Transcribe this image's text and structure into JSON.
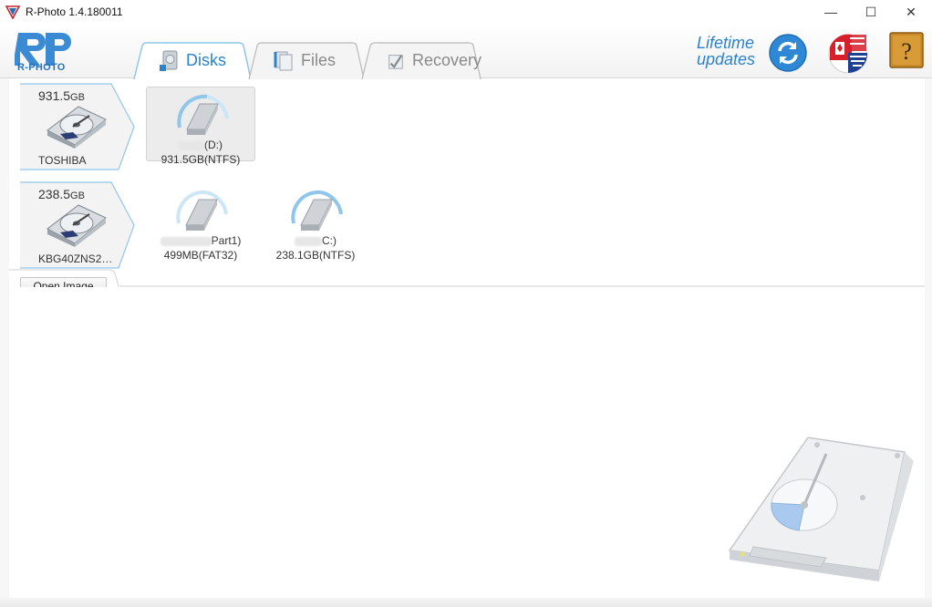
{
  "window": {
    "title": "R-Photo 1.4.180011",
    "minimize": "—",
    "maximize": "☐",
    "close": "✕"
  },
  "logo": {
    "text": "R-PHOTO"
  },
  "tabs": [
    {
      "label": "Disks",
      "active": true
    },
    {
      "label": "Files",
      "active": false
    },
    {
      "label": "Recovery",
      "active": false
    }
  ],
  "header": {
    "lifetime_line1": "Lifetime",
    "lifetime_line2": "updates",
    "help": "?"
  },
  "disks": [
    {
      "size": "931.5",
      "unit": "GB",
      "name": "TOSHIBA",
      "partitions": [
        {
          "label": "(D:)",
          "size": "931.5GB(NTFS)",
          "selected": true
        }
      ]
    },
    {
      "size": "238.5",
      "unit": "GB",
      "name": "KBG40ZNS2…",
      "partitions": [
        {
          "label": "Part1)",
          "size": "499MB(FAT32)",
          "selected": false
        },
        {
          "label": "C:)",
          "size": "238.1GB(NTFS)",
          "selected": false
        }
      ]
    }
  ],
  "image_bar": {
    "open_image": "Open Image"
  },
  "colors": {
    "accent": "#2a82cf",
    "tab_border": "#8fc6ea"
  }
}
